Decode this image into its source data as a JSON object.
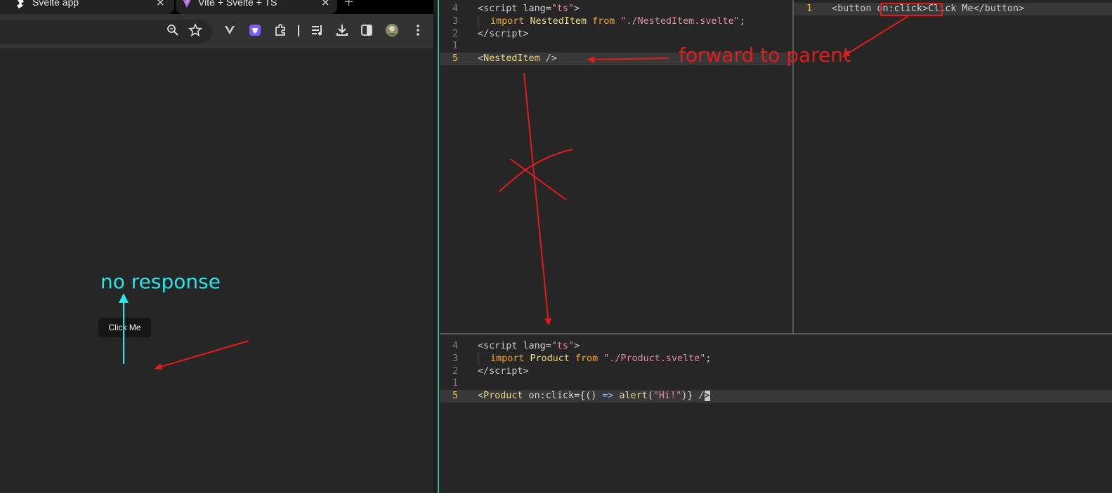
{
  "browser": {
    "tabs": [
      {
        "title": "Svelte app",
        "close": "×"
      },
      {
        "title": "Vite + Svelte + TS",
        "close": "×"
      }
    ],
    "new_tab": "+",
    "toolbar_icons": [
      "zoom-icon",
      "bookmark-star-icon",
      "extension-v-icon",
      "extension-shield-icon",
      "extensions-puzzle-icon",
      "media-queue-icon",
      "downloads-icon",
      "side-panel-icon",
      "profile-avatar",
      "menu-kebab-icon"
    ],
    "page": {
      "button_label": "Click Me"
    }
  },
  "editor": {
    "parent": {
      "lines": [
        {
          "n": "4",
          "tokens": [
            [
              "<",
              "c-tag"
            ],
            [
              "script",
              "c-tag"
            ],
            [
              " lang",
              "c-attr"
            ],
            [
              "=",
              "c-plain"
            ],
            [
              "\"ts\"",
              "c-str"
            ],
            [
              ">",
              "c-tag"
            ]
          ]
        },
        {
          "n": "3",
          "guide": true,
          "tokens": [
            [
              "import ",
              "c-kw"
            ],
            [
              "NestedItem",
              "c-id"
            ],
            [
              " from ",
              "c-kw2"
            ],
            [
              "\"./NestedItem.svelte\"",
              "c-str"
            ],
            [
              ";",
              "c-plain"
            ]
          ]
        },
        {
          "n": "2",
          "tokens": [
            [
              "</",
              "c-tag"
            ],
            [
              "script",
              "c-tag"
            ],
            [
              ">",
              "c-tag"
            ]
          ]
        },
        {
          "n": "1",
          "tokens": []
        },
        {
          "n": "5",
          "current": true,
          "tokens": [
            [
              "<",
              "c-tag"
            ],
            [
              "NestedItem",
              "c-comp"
            ],
            [
              " />",
              "c-tag"
            ]
          ]
        }
      ]
    },
    "nested": {
      "lines": [
        {
          "n": "1",
          "current": true,
          "tokens": [
            [
              "<",
              "c-tag"
            ],
            [
              "button",
              "c-tag"
            ],
            [
              " ",
              "c-plain"
            ],
            [
              "on:click",
              "c-attr"
            ],
            [
              ">",
              "c-tag"
            ],
            [
              "Click Me",
              "c-plain"
            ],
            [
              "</",
              "c-tag"
            ],
            [
              "button",
              "c-tag"
            ],
            [
              ">",
              "c-tag"
            ]
          ]
        }
      ]
    },
    "app": {
      "lines": [
        {
          "n": "4",
          "tokens": [
            [
              "<",
              "c-tag"
            ],
            [
              "script",
              "c-tag"
            ],
            [
              " lang",
              "c-attr"
            ],
            [
              "=",
              "c-plain"
            ],
            [
              "\"ts\"",
              "c-str"
            ],
            [
              ">",
              "c-tag"
            ]
          ]
        },
        {
          "n": "3",
          "guide": true,
          "tokens": [
            [
              "import ",
              "c-kw"
            ],
            [
              "Product",
              "c-id"
            ],
            [
              " from ",
              "c-kw2"
            ],
            [
              "\"./Product.svelte\"",
              "c-str"
            ],
            [
              ";",
              "c-plain"
            ]
          ]
        },
        {
          "n": "2",
          "tokens": [
            [
              "</",
              "c-tag"
            ],
            [
              "script",
              "c-tag"
            ],
            [
              ">",
              "c-tag"
            ]
          ]
        },
        {
          "n": "1",
          "tokens": []
        },
        {
          "n": "5",
          "current": true,
          "tokens": [
            [
              "<",
              "c-tag"
            ],
            [
              "Product",
              "c-comp"
            ],
            [
              " on:click",
              "c-attr"
            ],
            [
              "=",
              "c-plain"
            ],
            [
              "{",
              "c-plain"
            ],
            [
              "() ",
              "c-plain"
            ],
            [
              "=>",
              "c-op"
            ],
            [
              " alert",
              "c-fn"
            ],
            [
              "(",
              "c-plain"
            ],
            [
              "\"Hi!\"",
              "c-str"
            ],
            [
              ")",
              "c-plain"
            ],
            [
              "}",
              "c-plain"
            ],
            [
              " /",
              "c-tag"
            ],
            [
              ">",
              "cursor-block"
            ]
          ]
        }
      ]
    }
  },
  "annotations": {
    "forward_note": "forward to parent",
    "noresponse_note": "no response",
    "colors": {
      "red": "#e41b1b",
      "cyan": "#27e7ea"
    }
  }
}
